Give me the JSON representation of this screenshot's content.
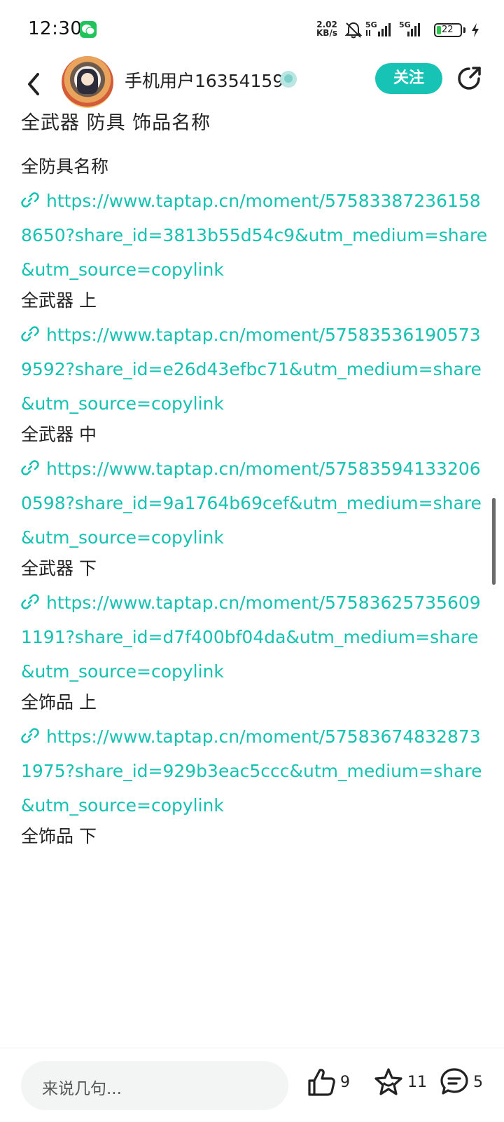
{
  "status": {
    "time": "12:30",
    "net_speed_value": "2.02",
    "net_speed_unit": "KB/s",
    "signal1": "5G",
    "signal2": "5G",
    "battery": "22"
  },
  "header": {
    "username": "手机用户16354159",
    "follow_label": "关注"
  },
  "post": {
    "title": "全武器 防具 饰品名称",
    "sections": [
      {
        "label": "全防具名称",
        "url": "https://www.taptap.cn/moment/575833872361588650?share_id=3813b55d54c9&utm_medium=share&utm_source=copylink"
      },
      {
        "label": "全武器 上",
        "url": "https://www.taptap.cn/moment/575835361905739592?share_id=e26d43efbc71&utm_medium=share&utm_source=copylink"
      },
      {
        "label": "全武器 中",
        "url": "https://www.taptap.cn/moment/575835941332060598?share_id=9a1764b69cef&utm_medium=share&utm_source=copylink"
      },
      {
        "label": "全武器 下",
        "url": "https://www.taptap.cn/moment/575836257356091191?share_id=d7f400bf04da&utm_medium=share&utm_source=copylink"
      },
      {
        "label": "全饰品 上",
        "url": "https://www.taptap.cn/moment/575836748328731975?share_id=929b3eac5ccc&utm_medium=share&utm_source=copylink"
      },
      {
        "label": "全饰品 下",
        "url": ""
      }
    ]
  },
  "bottom": {
    "comment_placeholder": "来说几句...",
    "like_count": "9",
    "favorite_count": "11",
    "comment_count": "5"
  },
  "colors": {
    "accent": "#15c2b1",
    "follow_bg": "#16c3b4"
  }
}
